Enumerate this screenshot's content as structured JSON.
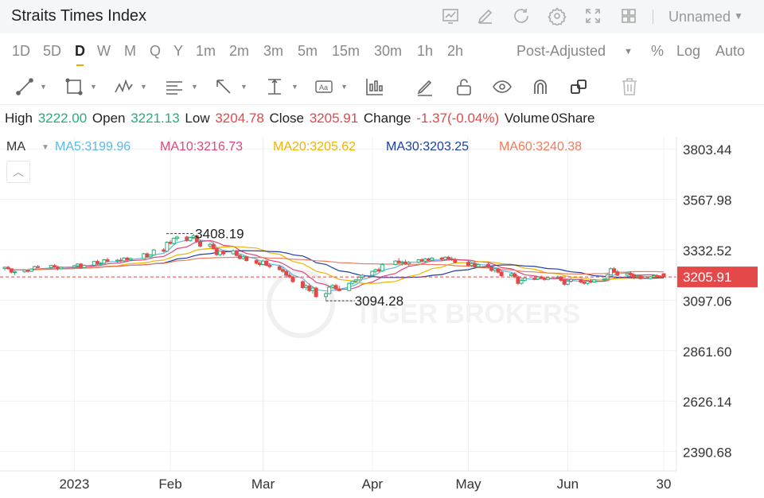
{
  "header": {
    "title": "Straits Times Index",
    "layout_name": "Unnamed",
    "icons": [
      "chart-icon",
      "edit-icon",
      "refresh-icon",
      "settings-icon",
      "fullscreen-icon",
      "grid-layout-icon"
    ]
  },
  "periods": [
    "1D",
    "5D",
    "D",
    "W",
    "M",
    "Q",
    "Y",
    "1m",
    "2m",
    "3m",
    "5m",
    "15m",
    "30m",
    "1h",
    "2h"
  ],
  "active_period": "D",
  "options": {
    "adjust": "Post-Adjusted",
    "percent": "%",
    "log": "Log",
    "auto": "Auto"
  },
  "tools": [
    "line-tool-icon",
    "rectangle-tool-icon",
    "pattern-tool-icon",
    "fibonacci-tool-icon",
    "arrow-tool-icon",
    "measure-tool-icon",
    "text-tool-icon",
    "indicator-tool-icon",
    "pen-icon",
    "lock-icon",
    "eye-icon",
    "magnet-icon",
    "layers-icon",
    "trash-icon"
  ],
  "quote": {
    "high_label": "High",
    "high": "3222.00",
    "open_label": "Open",
    "open": "3221.13",
    "low_label": "Low",
    "low": "3204.78",
    "close_label": "Close",
    "close": "3205.91",
    "change_label": "Change",
    "change": "-1.37(-0.04%)",
    "volume_label": "Volume",
    "volume": "0Share"
  },
  "ma_legend": {
    "label": "MA",
    "items": [
      {
        "text": "MA5:3199.96",
        "color": "#5bb8e8"
      },
      {
        "text": "MA10:3216.73",
        "color": "#e0457b"
      },
      {
        "text": "MA20:3205.62",
        "color": "#f0b400"
      },
      {
        "text": "MA30:3203.25",
        "color": "#1a3fa6"
      },
      {
        "text": "MA60:3240.38",
        "color": "#f07a5a"
      }
    ]
  },
  "watermark": "TIGER BROKERS",
  "chart_data": {
    "type": "candlestick",
    "ylim": [
      2300,
      3860
    ],
    "y_ticks": [
      3803.44,
      3567.98,
      3332.52,
      3097.06,
      2861.6,
      2626.14,
      2390.68
    ],
    "y_tick_labels": [
      "3803.44",
      "3567.98",
      "3332.52",
      "3097.06",
      "2861.60",
      "2626.14",
      "2390.68"
    ],
    "x_range": [
      "2022-12-13",
      "2023-06-30"
    ],
    "x_ticks": [
      {
        "date": "2023-01-03",
        "label": "2023"
      },
      {
        "date": "2023-02-01",
        "label": "Feb"
      },
      {
        "date": "2023-03-01",
        "label": "Mar"
      },
      {
        "date": "2023-04-03",
        "label": "Apr"
      },
      {
        "date": "2023-05-02",
        "label": "May"
      },
      {
        "date": "2023-06-01",
        "label": "Jun"
      },
      {
        "date": "2023-06-30",
        "label": "30"
      }
    ],
    "last_price": {
      "value": 3205.91,
      "label": "3205.91",
      "color": "#e54848"
    },
    "annotations": [
      {
        "label": "3408.19",
        "date": "2023-02-08",
        "value": 3408.19,
        "kind": "high"
      },
      {
        "label": "3094.28",
        "date": "2023-03-20",
        "value": 3094.28,
        "kind": "low"
      }
    ],
    "candles": [
      {
        "d": "2022-12-13",
        "o": 3245,
        "h": 3255,
        "l": 3236,
        "c": 3251
      },
      {
        "d": "2022-12-14",
        "o": 3251,
        "h": 3258,
        "l": 3240,
        "c": 3244
      },
      {
        "d": "2022-12-15",
        "o": 3244,
        "h": 3246,
        "l": 3222,
        "c": 3228
      },
      {
        "d": "2022-12-16",
        "o": 3228,
        "h": 3235,
        "l": 3215,
        "c": 3230
      },
      {
        "d": "2022-12-19",
        "o": 3230,
        "h": 3242,
        "l": 3225,
        "c": 3238
      },
      {
        "d": "2022-12-20",
        "o": 3238,
        "h": 3244,
        "l": 3226,
        "c": 3232
      },
      {
        "d": "2022-12-21",
        "o": 3232,
        "h": 3246,
        "l": 3230,
        "c": 3243
      },
      {
        "d": "2022-12-22",
        "o": 3243,
        "h": 3258,
        "l": 3240,
        "c": 3254
      },
      {
        "d": "2022-12-23",
        "o": 3254,
        "h": 3262,
        "l": 3246,
        "c": 3250
      },
      {
        "d": "2022-12-27",
        "o": 3250,
        "h": 3263,
        "l": 3245,
        "c": 3259
      },
      {
        "d": "2022-12-28",
        "o": 3259,
        "h": 3266,
        "l": 3248,
        "c": 3252
      },
      {
        "d": "2022-12-29",
        "o": 3252,
        "h": 3258,
        "l": 3236,
        "c": 3244
      },
      {
        "d": "2022-12-30",
        "o": 3244,
        "h": 3254,
        "l": 3240,
        "c": 3251
      },
      {
        "d": "2023-01-03",
        "o": 3251,
        "h": 3262,
        "l": 3246,
        "c": 3258
      },
      {
        "d": "2023-01-04",
        "o": 3258,
        "h": 3270,
        "l": 3250,
        "c": 3266
      },
      {
        "d": "2023-01-05",
        "o": 3266,
        "h": 3271,
        "l": 3244,
        "c": 3250
      },
      {
        "d": "2023-01-06",
        "o": 3250,
        "h": 3264,
        "l": 3246,
        "c": 3260
      },
      {
        "d": "2023-01-09",
        "o": 3260,
        "h": 3282,
        "l": 3256,
        "c": 3278
      },
      {
        "d": "2023-01-10",
        "o": 3278,
        "h": 3286,
        "l": 3262,
        "c": 3268
      },
      {
        "d": "2023-01-11",
        "o": 3268,
        "h": 3276,
        "l": 3258,
        "c": 3270
      },
      {
        "d": "2023-01-12",
        "o": 3270,
        "h": 3290,
        "l": 3266,
        "c": 3286
      },
      {
        "d": "2023-01-13",
        "o": 3286,
        "h": 3296,
        "l": 3274,
        "c": 3280
      },
      {
        "d": "2023-01-16",
        "o": 3280,
        "h": 3290,
        "l": 3270,
        "c": 3284
      },
      {
        "d": "2023-01-17",
        "o": 3284,
        "h": 3296,
        "l": 3276,
        "c": 3281
      },
      {
        "d": "2023-01-18",
        "o": 3281,
        "h": 3298,
        "l": 3277,
        "c": 3294
      },
      {
        "d": "2023-01-19",
        "o": 3294,
        "h": 3300,
        "l": 3280,
        "c": 3286
      },
      {
        "d": "2023-01-20",
        "o": 3286,
        "h": 3296,
        "l": 3280,
        "c": 3292
      },
      {
        "d": "2023-01-24",
        "o": 3292,
        "h": 3318,
        "l": 3290,
        "c": 3314
      },
      {
        "d": "2023-01-25",
        "o": 3314,
        "h": 3320,
        "l": 3296,
        "c": 3300
      },
      {
        "d": "2023-01-26",
        "o": 3300,
        "h": 3312,
        "l": 3292,
        "c": 3308
      },
      {
        "d": "2023-01-27",
        "o": 3308,
        "h": 3336,
        "l": 3304,
        "c": 3332
      },
      {
        "d": "2023-01-30",
        "o": 3332,
        "h": 3340,
        "l": 3320,
        "c": 3326
      },
      {
        "d": "2023-01-31",
        "o": 3326,
        "h": 3372,
        "l": 3322,
        "c": 3368
      },
      {
        "d": "2023-02-01",
        "o": 3368,
        "h": 3378,
        "l": 3356,
        "c": 3362
      },
      {
        "d": "2023-02-02",
        "o": 3362,
        "h": 3390,
        "l": 3358,
        "c": 3386
      },
      {
        "d": "2023-02-03",
        "o": 3386,
        "h": 3398,
        "l": 3376,
        "c": 3392
      },
      {
        "d": "2023-02-06",
        "o": 3392,
        "h": 3398,
        "l": 3370,
        "c": 3376
      },
      {
        "d": "2023-02-07",
        "o": 3376,
        "h": 3394,
        "l": 3370,
        "c": 3390
      },
      {
        "d": "2023-02-08",
        "o": 3390,
        "h": 3408.19,
        "l": 3382,
        "c": 3398
      },
      {
        "d": "2023-02-09",
        "o": 3398,
        "h": 3404,
        "l": 3366,
        "c": 3372
      },
      {
        "d": "2023-02-10",
        "o": 3372,
        "h": 3380,
        "l": 3344,
        "c": 3350
      },
      {
        "d": "2023-02-13",
        "o": 3350,
        "h": 3366,
        "l": 3340,
        "c": 3358
      },
      {
        "d": "2023-02-14",
        "o": 3358,
        "h": 3368,
        "l": 3332,
        "c": 3338
      },
      {
        "d": "2023-02-15",
        "o": 3338,
        "h": 3344,
        "l": 3304,
        "c": 3310
      },
      {
        "d": "2023-02-16",
        "o": 3310,
        "h": 3330,
        "l": 3304,
        "c": 3326
      },
      {
        "d": "2023-02-17",
        "o": 3326,
        "h": 3332,
        "l": 3306,
        "c": 3314
      },
      {
        "d": "2023-02-20",
        "o": 3314,
        "h": 3334,
        "l": 3310,
        "c": 3328
      },
      {
        "d": "2023-02-21",
        "o": 3328,
        "h": 3332,
        "l": 3302,
        "c": 3306
      },
      {
        "d": "2023-02-22",
        "o": 3306,
        "h": 3312,
        "l": 3288,
        "c": 3292
      },
      {
        "d": "2023-02-23",
        "o": 3292,
        "h": 3306,
        "l": 3286,
        "c": 3300
      },
      {
        "d": "2023-02-24",
        "o": 3300,
        "h": 3304,
        "l": 3278,
        "c": 3282
      },
      {
        "d": "2023-02-27",
        "o": 3282,
        "h": 3290,
        "l": 3264,
        "c": 3270
      },
      {
        "d": "2023-02-28",
        "o": 3270,
        "h": 3278,
        "l": 3256,
        "c": 3264
      },
      {
        "d": "2023-03-01",
        "o": 3264,
        "h": 3286,
        "l": 3260,
        "c": 3280
      },
      {
        "d": "2023-03-02",
        "o": 3280,
        "h": 3284,
        "l": 3256,
        "c": 3260
      },
      {
        "d": "2023-03-03",
        "o": 3260,
        "h": 3270,
        "l": 3246,
        "c": 3254
      },
      {
        "d": "2023-03-06",
        "o": 3254,
        "h": 3262,
        "l": 3236,
        "c": 3240
      },
      {
        "d": "2023-03-07",
        "o": 3240,
        "h": 3252,
        "l": 3226,
        "c": 3232
      },
      {
        "d": "2023-03-08",
        "o": 3232,
        "h": 3238,
        "l": 3208,
        "c": 3214
      },
      {
        "d": "2023-03-09",
        "o": 3214,
        "h": 3226,
        "l": 3200,
        "c": 3206
      },
      {
        "d": "2023-03-10",
        "o": 3206,
        "h": 3212,
        "l": 3178,
        "c": 3184
      },
      {
        "d": "2023-03-13",
        "o": 3184,
        "h": 3190,
        "l": 3150,
        "c": 3156
      },
      {
        "d": "2023-03-14",
        "o": 3156,
        "h": 3172,
        "l": 3144,
        "c": 3164
      },
      {
        "d": "2023-03-15",
        "o": 3164,
        "h": 3176,
        "l": 3136,
        "c": 3142
      },
      {
        "d": "2023-03-16",
        "o": 3142,
        "h": 3162,
        "l": 3128,
        "c": 3154
      },
      {
        "d": "2023-03-17",
        "o": 3154,
        "h": 3160,
        "l": 3108,
        "c": 3114
      },
      {
        "d": "2023-03-20",
        "o": 3114,
        "h": 3134,
        "l": 3094.28,
        "c": 3128
      },
      {
        "d": "2023-03-21",
        "o": 3128,
        "h": 3162,
        "l": 3126,
        "c": 3158
      },
      {
        "d": "2023-03-22",
        "o": 3158,
        "h": 3172,
        "l": 3150,
        "c": 3166
      },
      {
        "d": "2023-03-23",
        "o": 3166,
        "h": 3174,
        "l": 3144,
        "c": 3150
      },
      {
        "d": "2023-03-24",
        "o": 3150,
        "h": 3164,
        "l": 3138,
        "c": 3142
      },
      {
        "d": "2023-03-27",
        "o": 3142,
        "h": 3180,
        "l": 3140,
        "c": 3176
      },
      {
        "d": "2023-03-28",
        "o": 3176,
        "h": 3190,
        "l": 3170,
        "c": 3186
      },
      {
        "d": "2023-03-29",
        "o": 3186,
        "h": 3196,
        "l": 3176,
        "c": 3192
      },
      {
        "d": "2023-03-30",
        "o": 3192,
        "h": 3208,
        "l": 3186,
        "c": 3204
      },
      {
        "d": "2023-03-31",
        "o": 3204,
        "h": 3220,
        "l": 3196,
        "c": 3214
      },
      {
        "d": "2023-04-03",
        "o": 3214,
        "h": 3236,
        "l": 3208,
        "c": 3232
      },
      {
        "d": "2023-04-04",
        "o": 3232,
        "h": 3244,
        "l": 3222,
        "c": 3240
      },
      {
        "d": "2023-04-05",
        "o": 3240,
        "h": 3250,
        "l": 3226,
        "c": 3234
      },
      {
        "d": "2023-04-06",
        "o": 3234,
        "h": 3270,
        "l": 3230,
        "c": 3264
      },
      {
        "d": "2023-04-10",
        "o": 3264,
        "h": 3284,
        "l": 3260,
        "c": 3280
      },
      {
        "d": "2023-04-11",
        "o": 3280,
        "h": 3294,
        "l": 3268,
        "c": 3272
      },
      {
        "d": "2023-04-12",
        "o": 3272,
        "h": 3282,
        "l": 3258,
        "c": 3276
      },
      {
        "d": "2023-04-13",
        "o": 3276,
        "h": 3286,
        "l": 3262,
        "c": 3268
      },
      {
        "d": "2023-04-14",
        "o": 3268,
        "h": 3280,
        "l": 3256,
        "c": 3274
      },
      {
        "d": "2023-04-17",
        "o": 3274,
        "h": 3290,
        "l": 3270,
        "c": 3286
      },
      {
        "d": "2023-04-18",
        "o": 3286,
        "h": 3294,
        "l": 3276,
        "c": 3280
      },
      {
        "d": "2023-04-19",
        "o": 3280,
        "h": 3294,
        "l": 3274,
        "c": 3290
      },
      {
        "d": "2023-04-20",
        "o": 3290,
        "h": 3296,
        "l": 3280,
        "c": 3284
      },
      {
        "d": "2023-04-21",
        "o": 3284,
        "h": 3298,
        "l": 3280,
        "c": 3294
      },
      {
        "d": "2023-04-24",
        "o": 3294,
        "h": 3300,
        "l": 3282,
        "c": 3288
      },
      {
        "d": "2023-04-25",
        "o": 3288,
        "h": 3302,
        "l": 3284,
        "c": 3298
      },
      {
        "d": "2023-04-26",
        "o": 3298,
        "h": 3304,
        "l": 3284,
        "c": 3290
      },
      {
        "d": "2023-04-27",
        "o": 3290,
        "h": 3300,
        "l": 3280,
        "c": 3286
      },
      {
        "d": "2023-04-28",
        "o": 3286,
        "h": 3296,
        "l": 3270,
        "c": 3274
      },
      {
        "d": "2023-05-02",
        "o": 3274,
        "h": 3282,
        "l": 3256,
        "c": 3260
      },
      {
        "d": "2023-05-03",
        "o": 3260,
        "h": 3274,
        "l": 3252,
        "c": 3268
      },
      {
        "d": "2023-05-04",
        "o": 3268,
        "h": 3276,
        "l": 3248,
        "c": 3254
      },
      {
        "d": "2023-05-05",
        "o": 3254,
        "h": 3270,
        "l": 3248,
        "c": 3264
      },
      {
        "d": "2023-05-08",
        "o": 3264,
        "h": 3272,
        "l": 3246,
        "c": 3252
      },
      {
        "d": "2023-05-09",
        "o": 3252,
        "h": 3258,
        "l": 3230,
        "c": 3236
      },
      {
        "d": "2023-05-10",
        "o": 3236,
        "h": 3248,
        "l": 3226,
        "c": 3244
      },
      {
        "d": "2023-05-11",
        "o": 3244,
        "h": 3250,
        "l": 3222,
        "c": 3228
      },
      {
        "d": "2023-05-12",
        "o": 3228,
        "h": 3236,
        "l": 3206,
        "c": 3212
      },
      {
        "d": "2023-05-15",
        "o": 3212,
        "h": 3226,
        "l": 3204,
        "c": 3220
      },
      {
        "d": "2023-05-16",
        "o": 3220,
        "h": 3228,
        "l": 3200,
        "c": 3206
      },
      {
        "d": "2023-05-17",
        "o": 3206,
        "h": 3212,
        "l": 3168,
        "c": 3176
      },
      {
        "d": "2023-05-18",
        "o": 3176,
        "h": 3196,
        "l": 3170,
        "c": 3190
      },
      {
        "d": "2023-05-19",
        "o": 3190,
        "h": 3206,
        "l": 3184,
        "c": 3200
      },
      {
        "d": "2023-05-22",
        "o": 3200,
        "h": 3212,
        "l": 3190,
        "c": 3196
      },
      {
        "d": "2023-05-23",
        "o": 3196,
        "h": 3210,
        "l": 3192,
        "c": 3206
      },
      {
        "d": "2023-05-24",
        "o": 3206,
        "h": 3214,
        "l": 3194,
        "c": 3200
      },
      {
        "d": "2023-05-25",
        "o": 3200,
        "h": 3208,
        "l": 3188,
        "c": 3194
      },
      {
        "d": "2023-05-26",
        "o": 3194,
        "h": 3206,
        "l": 3190,
        "c": 3202
      },
      {
        "d": "2023-05-29",
        "o": 3202,
        "h": 3212,
        "l": 3196,
        "c": 3206
      },
      {
        "d": "2023-05-30",
        "o": 3206,
        "h": 3210,
        "l": 3184,
        "c": 3190
      },
      {
        "d": "2023-05-31",
        "o": 3190,
        "h": 3196,
        "l": 3164,
        "c": 3172
      },
      {
        "d": "2023-06-01",
        "o": 3172,
        "h": 3190,
        "l": 3166,
        "c": 3186
      },
      {
        "d": "2023-06-02",
        "o": 3186,
        "h": 3200,
        "l": 3180,
        "c": 3194
      },
      {
        "d": "2023-06-05",
        "o": 3194,
        "h": 3198,
        "l": 3176,
        "c": 3182
      },
      {
        "d": "2023-06-06",
        "o": 3182,
        "h": 3192,
        "l": 3170,
        "c": 3176
      },
      {
        "d": "2023-06-07",
        "o": 3176,
        "h": 3190,
        "l": 3168,
        "c": 3186
      },
      {
        "d": "2023-06-08",
        "o": 3186,
        "h": 3196,
        "l": 3176,
        "c": 3182
      },
      {
        "d": "2023-06-09",
        "o": 3182,
        "h": 3196,
        "l": 3178,
        "c": 3192
      },
      {
        "d": "2023-06-12",
        "o": 3192,
        "h": 3200,
        "l": 3184,
        "c": 3196
      },
      {
        "d": "2023-06-13",
        "o": 3196,
        "h": 3220,
        "l": 3192,
        "c": 3216
      },
      {
        "d": "2023-06-14",
        "o": 3216,
        "h": 3250,
        "l": 3212,
        "c": 3244
      },
      {
        "d": "2023-06-15",
        "o": 3244,
        "h": 3252,
        "l": 3224,
        "c": 3230
      },
      {
        "d": "2023-06-16",
        "o": 3230,
        "h": 3238,
        "l": 3210,
        "c": 3214
      },
      {
        "d": "2023-06-19",
        "o": 3214,
        "h": 3228,
        "l": 3208,
        "c": 3222
      },
      {
        "d": "2023-06-20",
        "o": 3222,
        "h": 3232,
        "l": 3210,
        "c": 3216
      },
      {
        "d": "2023-06-21",
        "o": 3216,
        "h": 3222,
        "l": 3196,
        "c": 3202
      },
      {
        "d": "2023-06-22",
        "o": 3202,
        "h": 3216,
        "l": 3198,
        "c": 3210
      },
      {
        "d": "2023-06-23",
        "o": 3210,
        "h": 3214,
        "l": 3194,
        "c": 3198
      },
      {
        "d": "2023-06-26",
        "o": 3198,
        "h": 3210,
        "l": 3194,
        "c": 3206
      },
      {
        "d": "2023-06-27",
        "o": 3206,
        "h": 3216,
        "l": 3200,
        "c": 3212
      },
      {
        "d": "2023-06-28",
        "o": 3212,
        "h": 3218,
        "l": 3202,
        "c": 3208
      },
      {
        "d": "2023-06-29",
        "o": 3208,
        "h": 3214,
        "l": 3198,
        "c": 3207
      },
      {
        "d": "2023-06-30",
        "o": 3221.13,
        "h": 3222,
        "l": 3204.78,
        "c": 3205.91
      }
    ]
  }
}
